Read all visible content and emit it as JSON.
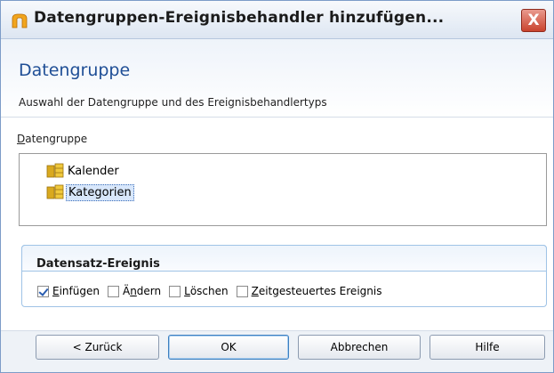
{
  "window": {
    "title": "Datengruppen-Ereignisbehandler hinzufügen...",
    "close_label": "X"
  },
  "header": {
    "heading": "Datengruppe",
    "subtitle": "Auswahl der Datengruppe und des Ereignisbehandlertyps"
  },
  "datagroup": {
    "label_accel": "D",
    "label_rest": "atengruppe",
    "items": [
      {
        "label": "Kalender",
        "selected": false
      },
      {
        "label": "Kategorien",
        "selected": true
      }
    ]
  },
  "event": {
    "title": "Datensatz-Ereignis",
    "options": [
      {
        "accel": "E",
        "rest": "infügen",
        "checked": true
      },
      {
        "pre": "Ä",
        "accel": "n",
        "rest": "dern",
        "checked": false
      },
      {
        "accel": "L",
        "rest": "öschen",
        "checked": false
      },
      {
        "accel": "Z",
        "rest": "eitgesteuertes Ereignis",
        "checked": false
      }
    ]
  },
  "buttons": {
    "back": "< Zurück",
    "ok": "OK",
    "cancel": "Abbrechen",
    "help": "Hilfe"
  },
  "icons": {
    "app": "app-icon",
    "datagroup": "database-icon",
    "close": "close-icon"
  }
}
